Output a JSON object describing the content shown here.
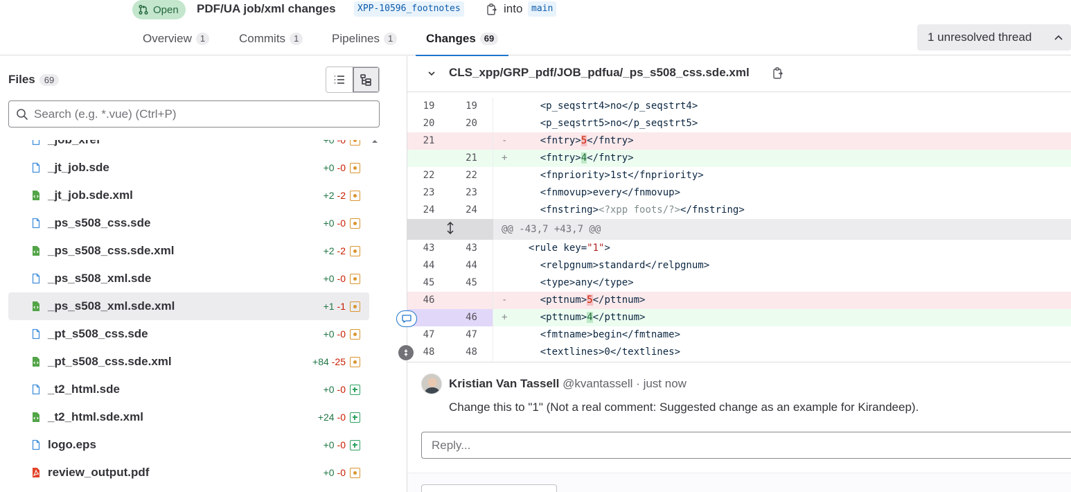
{
  "header": {
    "status": "Open",
    "title": "PDF/UA job/xml changes",
    "source_branch": "XPP-10596_footnotes",
    "into": "into",
    "target_branch": "main"
  },
  "tabs": [
    {
      "label": "Overview",
      "count": "1"
    },
    {
      "label": "Commits",
      "count": "1"
    },
    {
      "label": "Pipelines",
      "count": "1"
    },
    {
      "label": "Changes",
      "count": "69"
    }
  ],
  "thread_button": "1 unresolved thread",
  "sidebar": {
    "title": "Files",
    "count": "69",
    "search_placeholder": "Search (e.g. *.vue) (Ctrl+P)",
    "files": [
      {
        "name": "_job_xref",
        "add": "+0",
        "del": "-0",
        "type": "doc",
        "status": "modified"
      },
      {
        "name": "_jt_job.sde",
        "add": "+0",
        "del": "-0",
        "type": "doc",
        "status": "modified"
      },
      {
        "name": "_jt_job.sde.xml",
        "add": "+2",
        "del": "-2",
        "type": "xml",
        "status": "modified"
      },
      {
        "name": "_ps_s508_css.sde",
        "add": "+0",
        "del": "-0",
        "type": "doc",
        "status": "modified"
      },
      {
        "name": "_ps_s508_css.sde.xml",
        "add": "+2",
        "del": "-2",
        "type": "xml",
        "status": "modified"
      },
      {
        "name": "_ps_s508_xml.sde",
        "add": "+0",
        "del": "-0",
        "type": "doc",
        "status": "modified"
      },
      {
        "name": "_ps_s508_xml.sde.xml",
        "add": "+1",
        "del": "-1",
        "type": "xml",
        "status": "modified",
        "selected": true
      },
      {
        "name": "_pt_s508_css.sde",
        "add": "+0",
        "del": "-0",
        "type": "doc",
        "status": "modified"
      },
      {
        "name": "_pt_s508_css.sde.xml",
        "add": "+84",
        "del": "-25",
        "type": "xml",
        "status": "modified"
      },
      {
        "name": "_t2_html.sde",
        "add": "+0",
        "del": "-0",
        "type": "doc",
        "status": "added"
      },
      {
        "name": "_t2_html.sde.xml",
        "add": "+24",
        "del": "-0",
        "type": "xml",
        "status": "added"
      },
      {
        "name": "logo.eps",
        "add": "+0",
        "del": "-0",
        "type": "doc",
        "status": "added"
      },
      {
        "name": "review_output.pdf",
        "add": "+0",
        "del": "-0",
        "type": "pdf",
        "status": "modified"
      }
    ]
  },
  "diff": {
    "file_path": "CLS_xpp/GRP_pdf/JOB_pdfua/_ps_s508_css.sde.xml",
    "lines": [
      {
        "kind": "ctx",
        "old": "19",
        "new": "19",
        "sign": "",
        "code": "    <p_seqstrt4>no</p_seqstrt4>"
      },
      {
        "kind": "ctx",
        "old": "20",
        "new": "20",
        "sign": "",
        "code": "    <p_seqstrt5>no</p_seqstrt5>"
      },
      {
        "kind": "del",
        "old": "21",
        "new": "",
        "sign": "-",
        "pre": "    <fntry>",
        "tok": "5",
        "post": "</fntry>"
      },
      {
        "kind": "add",
        "old": "",
        "new": "21",
        "sign": "+",
        "pre": "    <fntry>",
        "tok": "4",
        "post": "</fntry>"
      },
      {
        "kind": "ctx",
        "old": "22",
        "new": "22",
        "sign": "",
        "code": "    <fnpriority>1st</fnpriority>"
      },
      {
        "kind": "ctx",
        "old": "23",
        "new": "23",
        "sign": "",
        "code": "    <fnmovup>every</fnmovup>"
      },
      {
        "kind": "pi",
        "old": "24",
        "new": "24",
        "sign": "",
        "pre": "    <fnstring>",
        "tok": "<?xpp foots/?>",
        "post": "</fnstring>"
      },
      {
        "kind": "hunk",
        "code": "@@ -43,7 +43,7 @@"
      },
      {
        "kind": "attr",
        "old": "43",
        "new": "43",
        "sign": "",
        "pre": "  <rule key=",
        "tok": "\"1\"",
        "post": ">"
      },
      {
        "kind": "ctx",
        "old": "44",
        "new": "44",
        "sign": "",
        "code": "    <relpgnum>standard</relpgnum>"
      },
      {
        "kind": "ctx",
        "old": "45",
        "new": "45",
        "sign": "",
        "code": "    <type>any</type>"
      },
      {
        "kind": "del",
        "old": "46",
        "new": "",
        "sign": "-",
        "pre": "    <pttnum>",
        "tok": "5",
        "post": "</pttnum>"
      },
      {
        "kind": "add",
        "old": "",
        "new": "46",
        "sign": "+",
        "pre": "    <pttnum>",
        "tok": "4",
        "post": "</pttnum>",
        "highlight": true
      },
      {
        "kind": "ctx",
        "old": "47",
        "new": "47",
        "sign": "",
        "code": "    <fmtname>begin</fmtname>"
      },
      {
        "kind": "ctx",
        "old": "48",
        "new": "48",
        "sign": "",
        "code": "    <textlines>0</textlines>"
      }
    ]
  },
  "comment": {
    "author": "Kristian Van Tassell",
    "handle": "@kvantassell · just now",
    "text": "Change this to \"1\" (Not a real comment: Suggested change as an example for Kirandeep).",
    "reply_placeholder": "Reply..."
  },
  "colors": {
    "accent": "#1f75cb",
    "added": "#217645",
    "removed": "#c91c00",
    "status_open_bg": "#c3e6cd"
  }
}
